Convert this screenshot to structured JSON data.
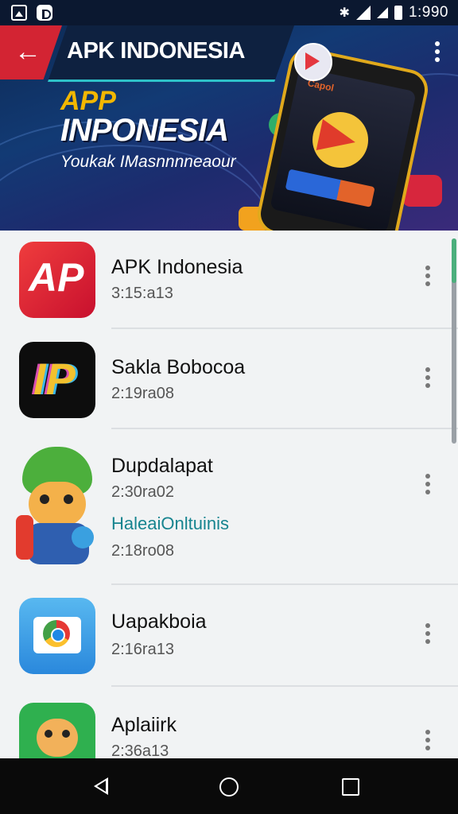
{
  "status_bar": {
    "time": "1:990",
    "bluetooth_glyph": "✱"
  },
  "header": {
    "title": "APK INDONESIA",
    "back_icon": "arrow-left-icon",
    "more_icon": "more-vert-icon"
  },
  "banner": {
    "line1": "APP",
    "line2": "INPONESIA",
    "line3": "Youkak IMasnnnneaour",
    "phone_tag": "Capol"
  },
  "apps": [
    {
      "name": "APK Indonesia",
      "meta": "3:15:a13",
      "icon_text": "AP"
    },
    {
      "name": "Sakla Bobocoa",
      "meta": "2:19ra08",
      "icon_text": "IP"
    },
    {
      "name": "Dupdalapat",
      "meta": "2:30ra02",
      "extra_label": "HaleaiOnltuinis",
      "extra_meta": "2:18ro08"
    },
    {
      "name": "Uapakboia",
      "meta": "2:16ra13"
    },
    {
      "name": "Aplaiirk",
      "meta": "2:36a13"
    }
  ],
  "colors": {
    "accent_red": "#d32433",
    "teal": "#16848f",
    "header_dark": "#0e2140"
  }
}
